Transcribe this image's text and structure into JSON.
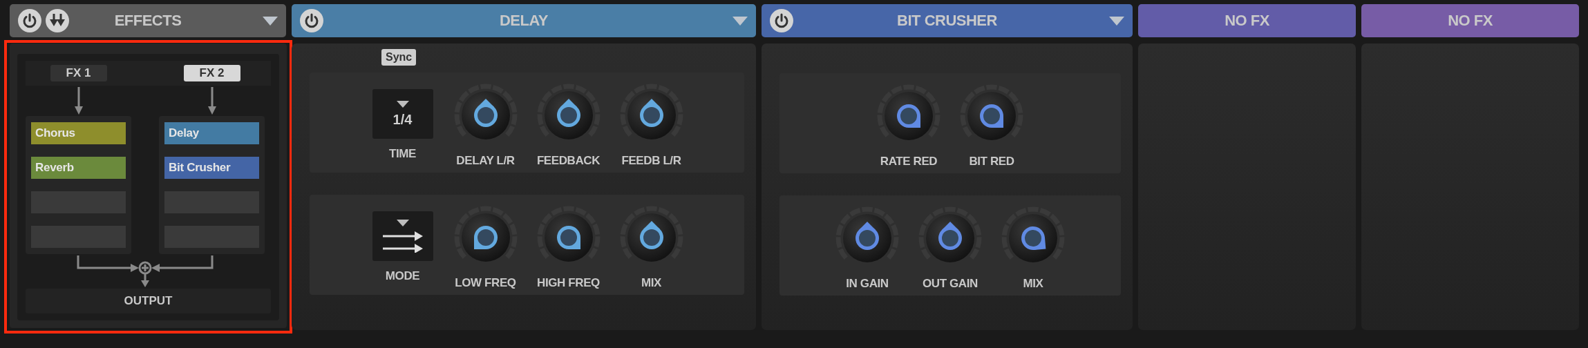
{
  "slots": [
    {
      "kind": "routing",
      "title": "EFFECTS",
      "color": "#5b5b5b",
      "highlighted": true,
      "fx_tabs": [
        {
          "label": "FX 1",
          "selected": false
        },
        {
          "label": "FX 2",
          "selected": true
        }
      ],
      "chains": [
        {
          "slots": [
            {
              "kind": "effect",
              "name": "Chorus",
              "color": "#8e8e2c"
            },
            {
              "kind": "effect",
              "name": "Reverb",
              "color": "#6b8a3c"
            },
            {
              "kind": "empty"
            },
            {
              "kind": "empty"
            }
          ]
        },
        {
          "slots": [
            {
              "kind": "effect",
              "name": "Delay",
              "color": "#437ba3"
            },
            {
              "kind": "effect",
              "name": "Bit Crusher",
              "color": "#4465a6"
            },
            {
              "kind": "empty"
            },
            {
              "kind": "empty"
            }
          ]
        }
      ],
      "output": "OUTPUT"
    },
    {
      "kind": "effect",
      "title": "DELAY",
      "color": "#4a7ea6",
      "sync": {
        "label": "Sync",
        "on": true
      },
      "rows": [
        [
          {
            "kind": "selector",
            "value": "1/4",
            "label": "TIME"
          },
          {
            "kind": "knob",
            "label": "DELAY L/R"
          },
          {
            "kind": "knob",
            "label": "FEEDBACK"
          },
          {
            "kind": "knob",
            "label": "FEEDB L/R"
          }
        ],
        [
          {
            "kind": "mode",
            "label": "MODE"
          },
          {
            "kind": "knob",
            "label": "LOW FREQ"
          },
          {
            "kind": "knob",
            "label": "HIGH FREQ"
          },
          {
            "kind": "knob",
            "label": "MIX"
          }
        ]
      ]
    },
    {
      "kind": "effect",
      "title": "BIT CRUSHER",
      "color": "#4766a8",
      "rows": [
        [
          {
            "kind": "knob",
            "label": "RATE RED"
          },
          {
            "kind": "knob",
            "label": "BIT RED"
          }
        ],
        [
          {
            "kind": "knob",
            "label": "IN GAIN"
          },
          {
            "kind": "knob",
            "label": "OUT GAIN"
          },
          {
            "kind": "knob",
            "label": "MIX"
          }
        ]
      ]
    },
    {
      "kind": "empty",
      "title": "NO FX",
      "color": "#625ca8"
    },
    {
      "kind": "empty",
      "title": "NO FX",
      "color": "#775ca6"
    }
  ]
}
